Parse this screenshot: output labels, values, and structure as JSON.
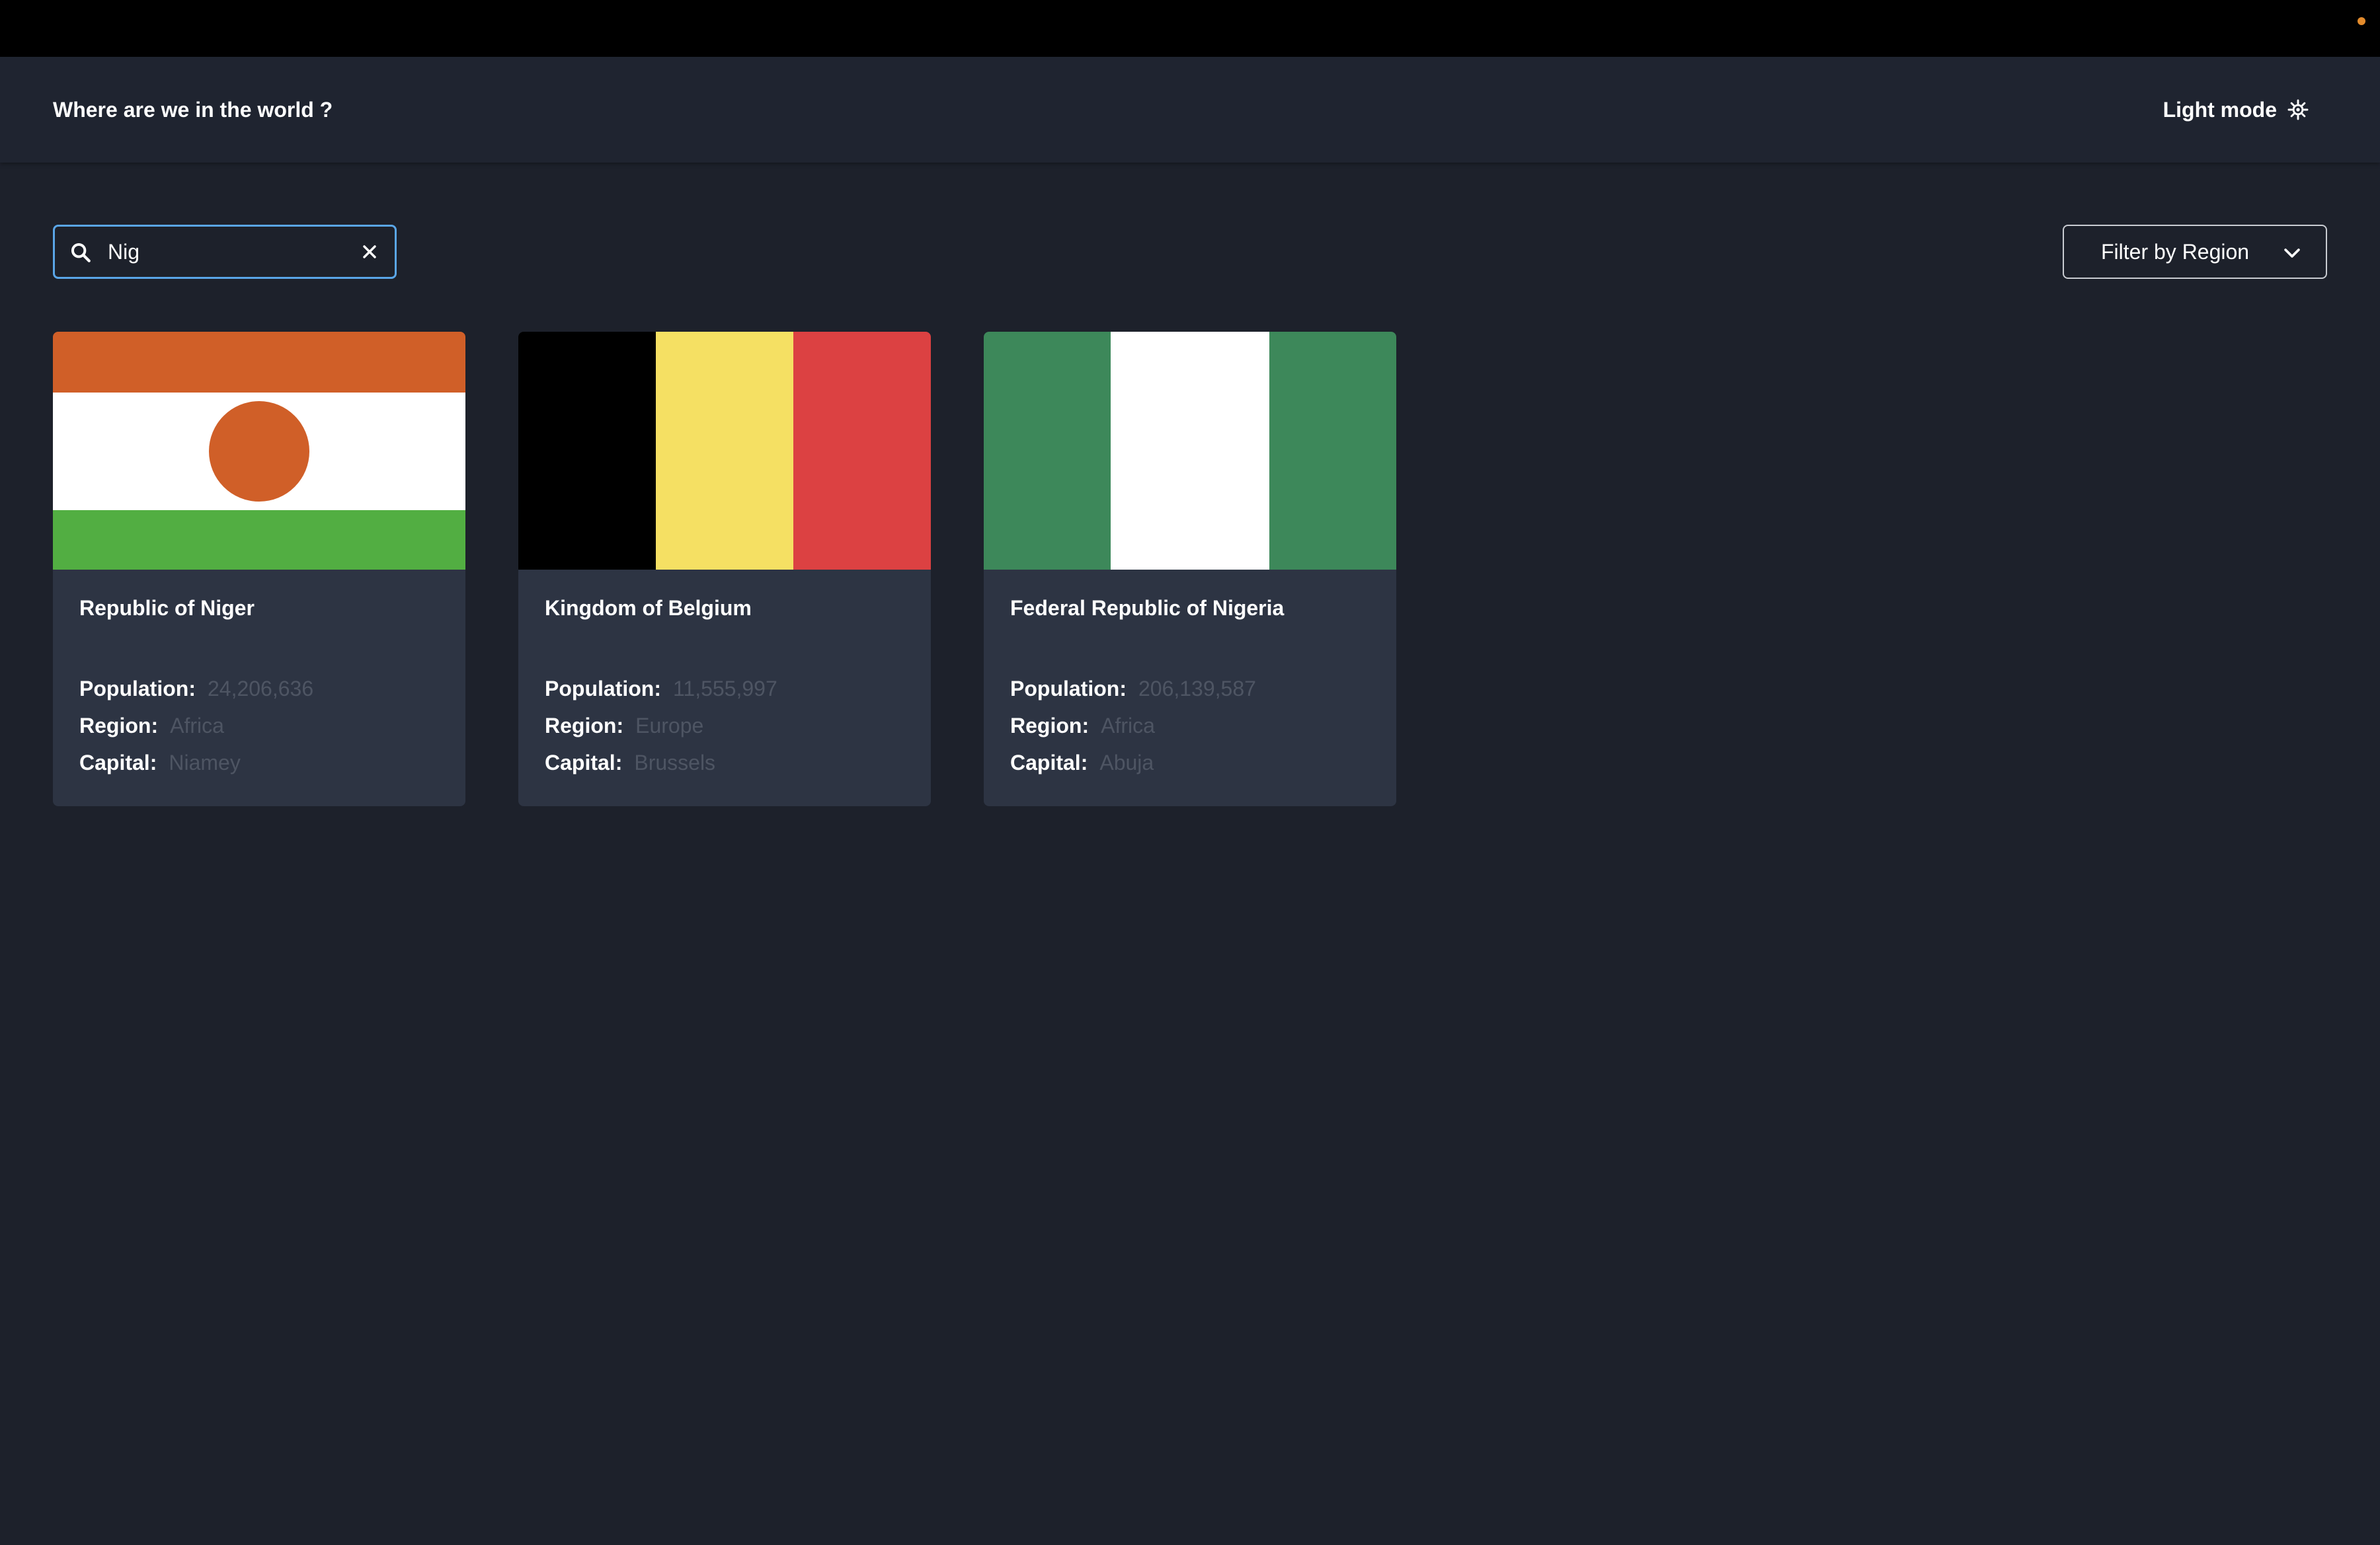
{
  "header": {
    "title": "Where are we in the world ?",
    "theme_toggle_label": "Light mode",
    "theme_icon": "gear-icon"
  },
  "search": {
    "value": "Nig",
    "placeholder": "",
    "search_icon": "search-icon",
    "clear_icon": "close-icon"
  },
  "filter": {
    "label": "Filter by Region",
    "icon": "chevron-down-icon"
  },
  "labels": {
    "population": "Population:",
    "region": "Region:",
    "capital": "Capital:"
  },
  "cards": [
    {
      "name": "Republic of Niger",
      "population": "24,206,636",
      "region": "Africa",
      "capital": "Niamey",
      "flag_colors": [
        "#d05f28",
        "#ffffff",
        "#52ae42"
      ]
    },
    {
      "name": "Kingdom of Belgium",
      "population": "11,555,997",
      "region": "Europe",
      "capital": "Brussels",
      "flag_colors": [
        "#000000",
        "#f5e063",
        "#dc4142"
      ]
    },
    {
      "name": "Federal Republic of Nigeria",
      "population": "206,139,587",
      "region": "Africa",
      "capital": "Abuja",
      "flag_colors": [
        "#3d885a",
        "#ffffff",
        "#3d885a"
      ]
    }
  ],
  "colors": {
    "background": "#1d212b",
    "card": "#2d3443",
    "accent_focus": "#5aa6e8",
    "muted_value": "#4e5563"
  }
}
